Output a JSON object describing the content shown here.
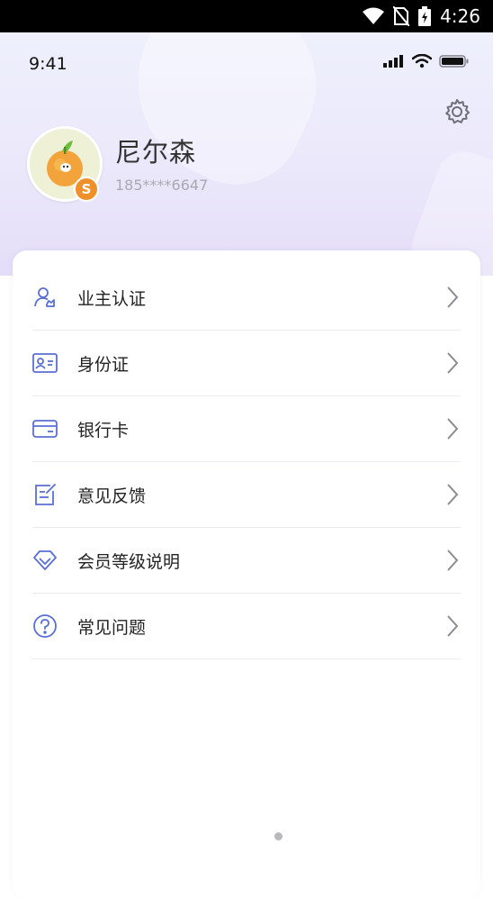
{
  "system_status": {
    "time": "4:26"
  },
  "ios_status": {
    "time": "9:41"
  },
  "profile": {
    "name": "尼尔森",
    "phone": "185****6647",
    "badge": "S"
  },
  "menu": [
    {
      "label": "业主认证",
      "icon": "owner-certify-icon"
    },
    {
      "label": "身份证",
      "icon": "id-card-icon"
    },
    {
      "label": "银行卡",
      "icon": "bank-card-icon"
    },
    {
      "label": "意见反馈",
      "icon": "feedback-icon"
    },
    {
      "label": "会员等级说明",
      "icon": "diamond-icon"
    },
    {
      "label": "常见问题",
      "icon": "question-icon"
    }
  ],
  "colors": {
    "accent": "#5a6fd3",
    "badge": "#f0902a",
    "hero_start": "#eef0fc",
    "hero_end": "#e4ddf8"
  }
}
